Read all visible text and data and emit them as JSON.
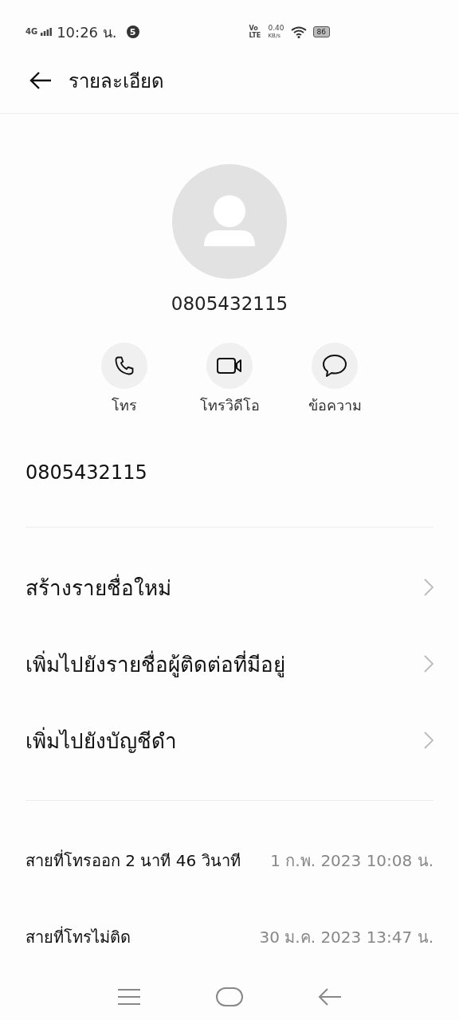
{
  "status_bar": {
    "network": "4G",
    "time": "10:26 น.",
    "notification_count": "5",
    "volte": "Vo LTE",
    "speed": "0.40",
    "speed_unit": "KB/s",
    "battery": "86"
  },
  "header": {
    "title": "รายละเอียด"
  },
  "contact": {
    "name": "0805432115"
  },
  "actions": [
    {
      "kind": "call",
      "label": "โทร"
    },
    {
      "kind": "video",
      "label": "โทรวิดีโอ"
    },
    {
      "kind": "message",
      "label": "ข้อความ"
    }
  ],
  "phone_number": "0805432115",
  "options": [
    {
      "label": "สร้างรายชื่อใหม่"
    },
    {
      "label": "เพิ่มไปยังรายชื่อผู้ติดต่อที่มีอยู่"
    },
    {
      "label": "เพิ่มไปยังบัญชีดำ"
    }
  ],
  "call_history": [
    {
      "description": "สายที่โทรออก 2 นาที 46 วินาที",
      "time": "1 ก.พ. 2023 10:08 น."
    },
    {
      "description": "สายที่โทรไม่ติด",
      "time": "30 ม.ค. 2023 13:47 น."
    }
  ]
}
